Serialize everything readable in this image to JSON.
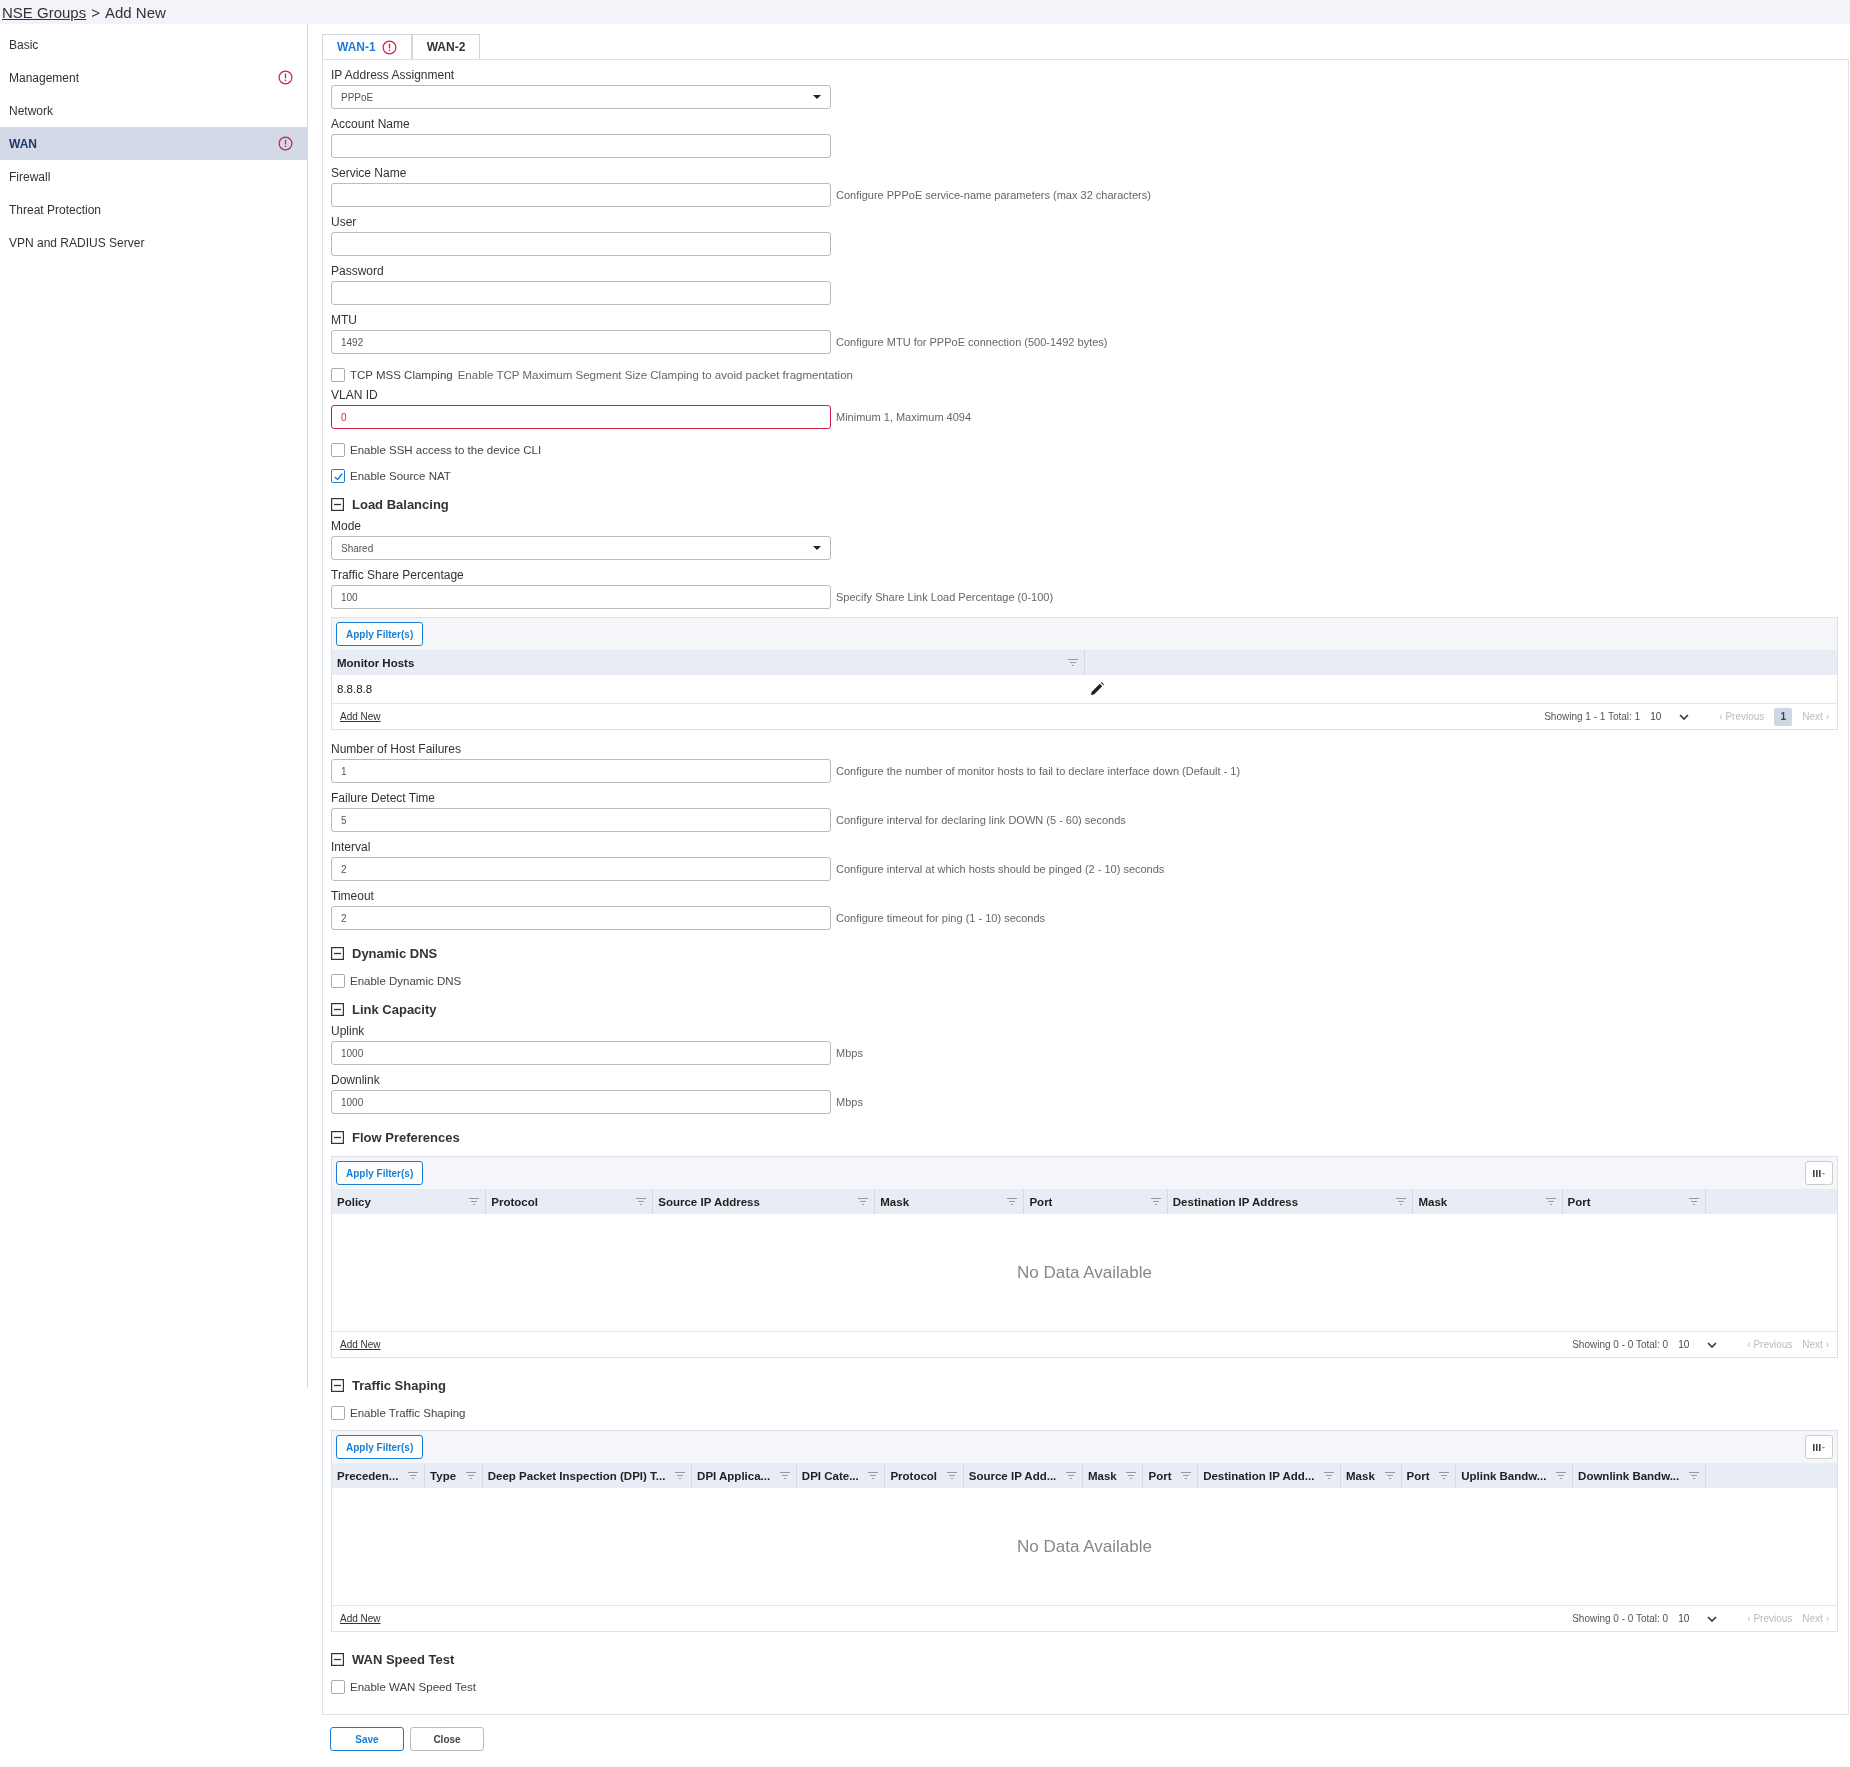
{
  "breadcrumb": {
    "parent": "NSE Groups",
    "separator": ">",
    "current": "Add New"
  },
  "sidebar": {
    "items": [
      {
        "label": "Basic",
        "selected": false,
        "warning": false
      },
      {
        "label": "Management",
        "selected": false,
        "warning": true
      },
      {
        "label": "Network",
        "selected": false,
        "warning": false
      },
      {
        "label": "WAN",
        "selected": true,
        "warning": true
      },
      {
        "label": "Firewall",
        "selected": false,
        "warning": false
      },
      {
        "label": "Threat Protection",
        "selected": false,
        "warning": false
      },
      {
        "label": "VPN and RADIUS Server",
        "selected": false,
        "warning": false
      }
    ]
  },
  "tabs": [
    {
      "label": "WAN-1",
      "selected": true,
      "warning": true
    },
    {
      "label": "WAN-2",
      "selected": false,
      "warning": false
    }
  ],
  "form": [
    {
      "kind": "select",
      "label": "IP Address Assignment",
      "value": "PPPoE"
    },
    {
      "kind": "input",
      "label": "Account Name"
    },
    {
      "kind": "input",
      "label": "Service Name",
      "hint": "Configure PPPoE service-name parameters (max 32 characters)"
    },
    {
      "kind": "input",
      "label": "User"
    },
    {
      "kind": "input",
      "label": "Password"
    },
    {
      "kind": "input",
      "label": "MTU",
      "value": "1492",
      "hint": "Configure MTU for PPPoE connection (500-1492 bytes)"
    },
    {
      "kind": "checkbox",
      "label": "TCP MSS Clamping",
      "description": "Enable TCP Maximum Segment Size Clamping to avoid packet fragmentation",
      "checked": false
    },
    {
      "kind": "input",
      "label": "VLAN ID",
      "value": "0",
      "invalid": true,
      "hint": "Minimum 1, Maximum 4094"
    },
    {
      "kind": "checkbox",
      "label": "Enable SSH access to the device CLI",
      "checked": false
    },
    {
      "kind": "checkbox",
      "label": "Enable Source NAT",
      "checked": true
    },
    {
      "kind": "section",
      "label": "Load Balancing",
      "expanded": true
    },
    {
      "kind": "select",
      "label": "Mode",
      "value": "Shared"
    },
    {
      "kind": "input",
      "label": "Traffic Share Percentage",
      "value": "100",
      "hint": "Specify Share Link Load Percentage (0-100)"
    },
    {
      "kind": "table",
      "filter_button": "Apply Filter(s)",
      "column_chooser": false,
      "columns": [
        "Monitor Hosts"
      ],
      "rows": [
        {
          "cells": [
            "8.8.8.8"
          ],
          "editable": true
        }
      ],
      "add_link": "Add New",
      "showing": "Showing 1 - 1 Total: 1",
      "page_size": "10",
      "previous": "‹ Previous",
      "next": "Next ›",
      "pages": [
        {
          "label": "1",
          "selected": true
        }
      ]
    },
    {
      "kind": "input",
      "label": "Number of Host Failures",
      "value": "1",
      "hint": "Configure the number of monitor hosts to fail to declare interface down (Default - 1)"
    },
    {
      "kind": "input",
      "label": "Failure Detect Time",
      "value": "5",
      "hint": "Configure interval for declaring link DOWN (5 - 60) seconds"
    },
    {
      "kind": "input",
      "label": "Interval",
      "value": "2",
      "hint": "Configure interval at which hosts should be pinged (2 - 10) seconds"
    },
    {
      "kind": "input",
      "label": "Timeout",
      "value": "2",
      "hint": "Configure timeout for ping (1 - 10) seconds"
    },
    {
      "kind": "section",
      "label": "Dynamic DNS",
      "expanded": true
    },
    {
      "kind": "checkbox",
      "label": "Enable Dynamic DNS",
      "checked": false
    },
    {
      "kind": "section",
      "label": "Link Capacity",
      "expanded": true
    },
    {
      "kind": "input",
      "label": "Uplink",
      "value": "1000",
      "hint": "Mbps"
    },
    {
      "kind": "input",
      "label": "Downlink",
      "value": "1000",
      "hint": "Mbps"
    },
    {
      "kind": "section",
      "label": "Flow Preferences",
      "expanded": true
    },
    {
      "kind": "table",
      "filter_button": "Apply Filter(s)",
      "column_chooser": true,
      "columns": [
        "Policy",
        "Protocol",
        "Source IP Address",
        "Mask",
        "Port",
        "Destination IP Address",
        "Mask",
        "Port"
      ],
      "empty_text": "No Data Available",
      "add_link": "Add New",
      "showing": "Showing 0 - 0 Total: 0",
      "page_size": "10",
      "previous": "‹ Previous",
      "next": "Next ›"
    },
    {
      "kind": "section",
      "label": "Traffic Shaping",
      "expanded": true
    },
    {
      "kind": "checkbox",
      "label": "Enable Traffic Shaping",
      "checked": false
    },
    {
      "kind": "table",
      "filter_button": "Apply Filter(s)",
      "column_chooser": true,
      "columns": [
        "Preceden...",
        "Type",
        "Deep Packet Inspection (DPI) T...",
        "DPI Applica...",
        "DPI Cate...",
        "Protocol",
        "Source IP Add...",
        "Mask",
        "Port",
        "Destination IP Add...",
        "Mask",
        "Port",
        "Uplink Bandw...",
        "Downlink Bandw..."
      ],
      "empty_text": "No Data Available",
      "add_link": "Add New",
      "showing": "Showing 0 - 0 Total: 0",
      "page_size": "10",
      "previous": "‹ Previous",
      "next": "Next ›"
    },
    {
      "kind": "section",
      "label": "WAN Speed Test",
      "expanded": true
    },
    {
      "kind": "checkbox",
      "label": "Enable WAN Speed Test",
      "checked": false
    }
  ],
  "buttons": [
    {
      "label": "Save",
      "kind": "primary"
    },
    {
      "label": "Close",
      "kind": "secondary"
    }
  ]
}
